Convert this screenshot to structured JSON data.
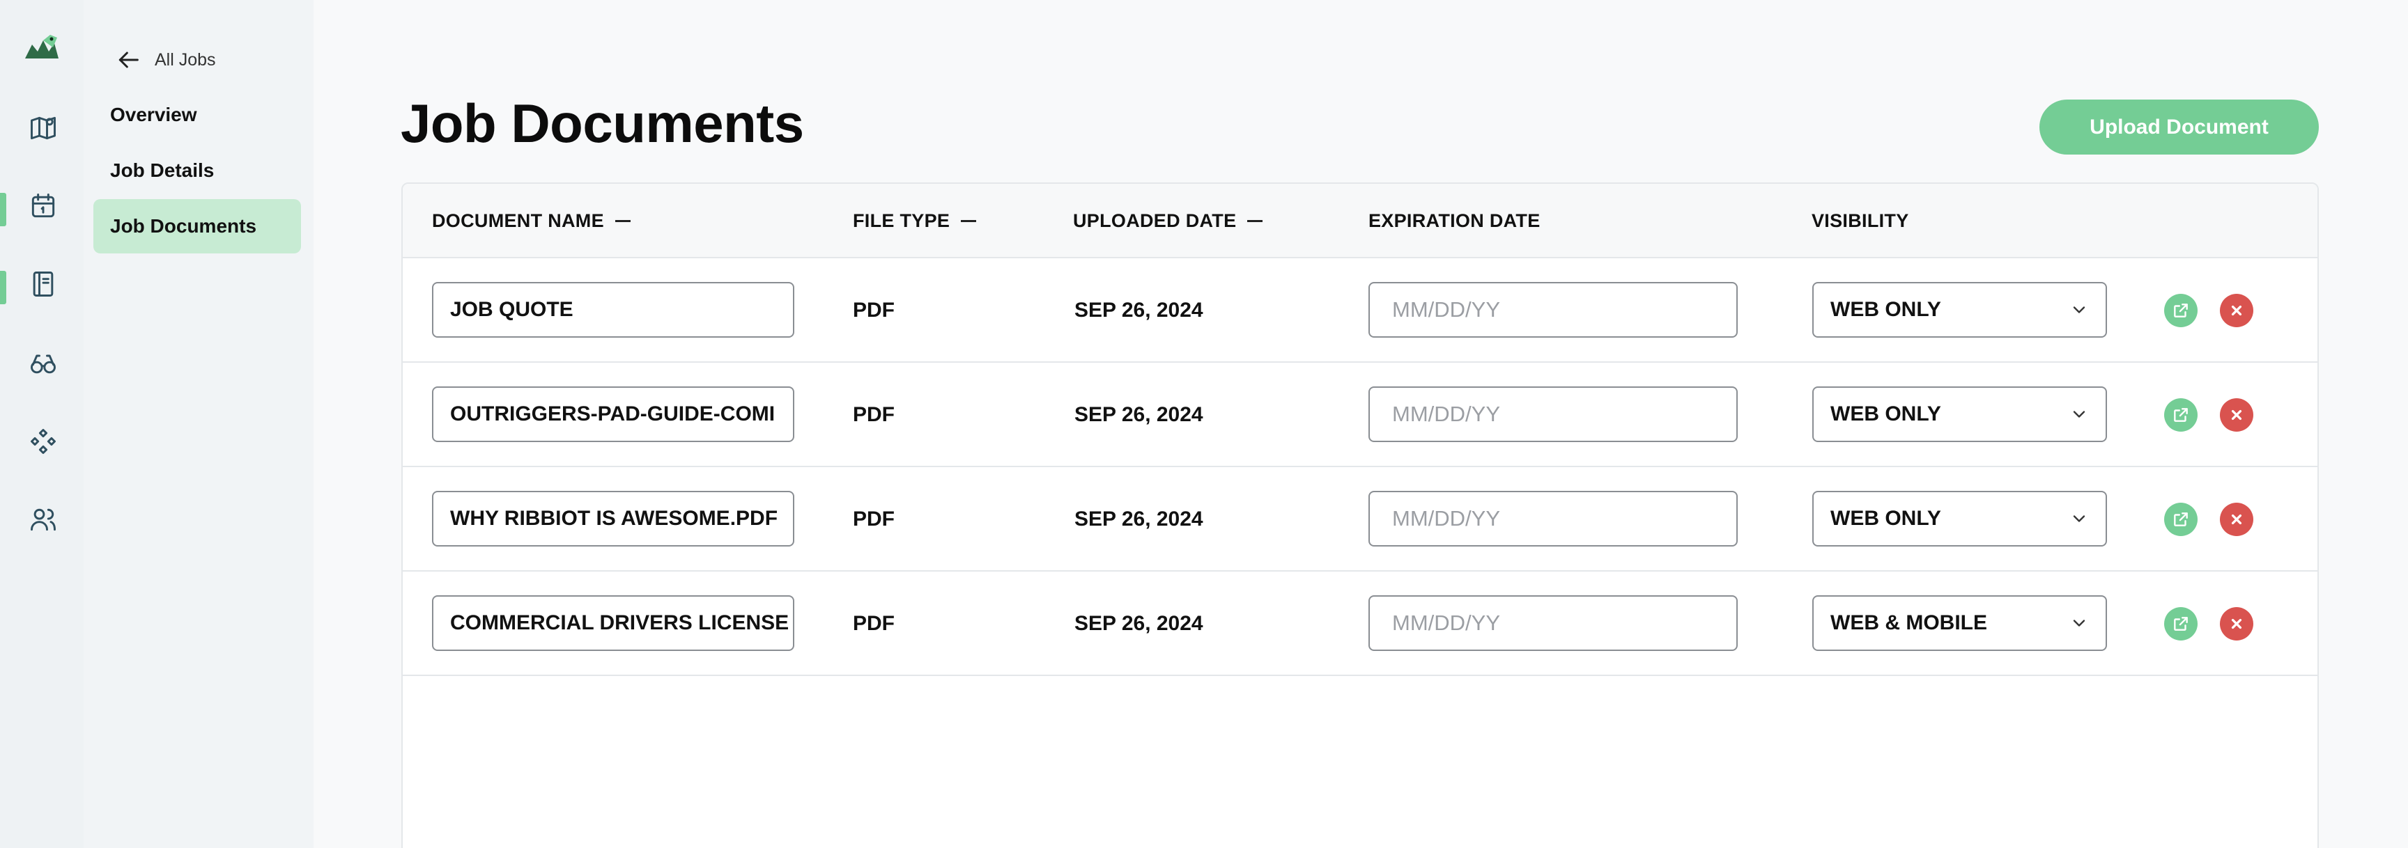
{
  "rail": {
    "items": [
      {
        "icon": "map-icon",
        "active": false
      },
      {
        "icon": "calendar-icon",
        "active": true
      },
      {
        "icon": "book-icon",
        "active": true
      },
      {
        "icon": "binoculars-icon",
        "active": false
      },
      {
        "icon": "grid-diamond-icon",
        "active": false
      },
      {
        "icon": "users-icon",
        "active": false
      }
    ]
  },
  "subnav": {
    "back_label": "All Jobs",
    "items": [
      {
        "label": "Overview",
        "active": false
      },
      {
        "label": "Job Details",
        "active": false
      },
      {
        "label": "Job Documents",
        "active": true
      }
    ]
  },
  "page": {
    "title": "Job Documents",
    "upload_label": "Upload Document"
  },
  "table": {
    "columns": {
      "name": "DOCUMENT NAME",
      "file_type": "FILE TYPE",
      "uploaded": "UPLOADED DATE",
      "expiration": "EXPIRATION DATE",
      "visibility": "VISIBILITY"
    },
    "date_placeholder": "MM/DD/YY",
    "rows": [
      {
        "name": "JOB QUOTE",
        "file_type": "PDF",
        "uploaded": "SEP 26, 2024",
        "expiration": "",
        "visibility": "WEB ONLY"
      },
      {
        "name": "OUTRIGGERS-PAD-GUIDE-COMI",
        "file_type": "PDF",
        "uploaded": "SEP 26, 2024",
        "expiration": "",
        "visibility": "WEB ONLY"
      },
      {
        "name": "WHY RIBBIOT IS AWESOME.PDF",
        "file_type": "PDF",
        "uploaded": "SEP 26, 2024",
        "expiration": "",
        "visibility": "WEB ONLY"
      },
      {
        "name": "COMMERCIAL DRIVERS LICENSE",
        "file_type": "PDF",
        "uploaded": "SEP 26, 2024",
        "expiration": "",
        "visibility": "WEB & MOBILE"
      }
    ]
  },
  "colors": {
    "accent": "#74cd95",
    "active_nav_bg": "#c7ebd3",
    "delete": "#d9534f"
  }
}
